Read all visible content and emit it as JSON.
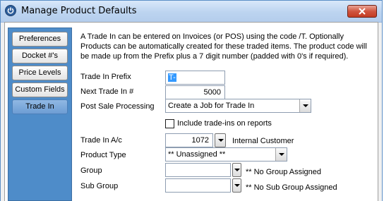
{
  "window": {
    "title": "Manage Product Defaults",
    "close_label": "close"
  },
  "sidebar": {
    "items": [
      {
        "label": "Preferences",
        "active": false
      },
      {
        "label": "Docket #'s",
        "active": false
      },
      {
        "label": "Price Levels",
        "active": false
      },
      {
        "label": "Custom Fields",
        "active": false
      },
      {
        "label": "Trade In",
        "active": true
      }
    ]
  },
  "main": {
    "description": "A Trade In can be entered on Invoices (or POS) using the code /T.  Optionally Products can be automatically created for these traded items.  The product code will be made up from the Prefix plus a 7 digit number (padded with 0's if required).",
    "trade_in_prefix": {
      "label": "Trade In Prefix",
      "value": "T-"
    },
    "next_trade_in": {
      "label": "Next Trade In #",
      "value": "5000"
    },
    "post_sale_processing": {
      "label": "Post Sale Processing",
      "value": "Create a Job for Trade In"
    },
    "include_on_reports": {
      "label": "Include trade-ins on reports",
      "checked": false
    },
    "trade_in_ac": {
      "label": "Trade In A/c",
      "value": "1072",
      "account_name": "Internal Customer"
    },
    "product_type": {
      "label": "Product Type",
      "value": "** Unassigned **"
    },
    "group": {
      "label": "Group",
      "value": "",
      "note": "** No Group Assigned"
    },
    "sub_group": {
      "label": "Sub Group",
      "value": "",
      "note": "** No Sub Group Assigned"
    }
  },
  "colors": {
    "sidebar_bg": "#4e8cc9",
    "active_tab": "#6d9dd4",
    "selection": "#3399ff",
    "close_button": "#c43c23"
  },
  "icons": [
    "power-icon",
    "close-icon",
    "chevron-down-icon"
  ]
}
